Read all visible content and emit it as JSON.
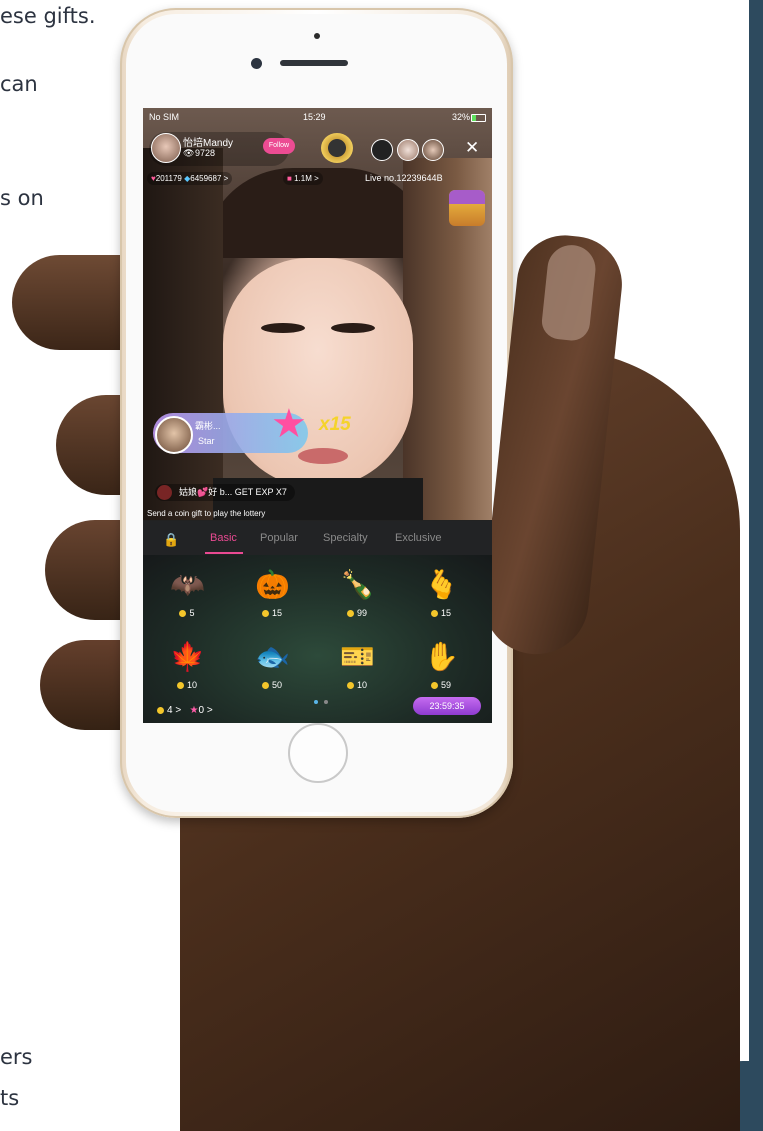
{
  "side_text": {
    "line1": "ese gifts.",
    "line2": "can",
    "line3": "s on",
    "line4": "ers",
    "line5": "ts"
  },
  "status_bar": {
    "carrier": "No SIM",
    "time": "15:29",
    "battery": "32%",
    "battery_level": 0.32
  },
  "streamer": {
    "name": "怡培Mandy",
    "viewers": "9728",
    "follow_label": "Follow"
  },
  "stats": {
    "likes": "201179",
    "diamonds": "6459687",
    "diamonds_more": ">",
    "gifts": "1.1M",
    "gifts_more": ">",
    "live_no": "Live no.12239644B"
  },
  "gift_event": {
    "user": "霸彬...",
    "gift_name": "Star",
    "count": "x15"
  },
  "chat": {
    "text": "姑娘💕好 b... GET EXP X7"
  },
  "lottery_text": "Send a coin gift to play the lottery",
  "tabs": [
    "Basic",
    "Popular",
    "Specialty",
    "Exclusive"
  ],
  "gifts": [
    {
      "name": "bat",
      "icon": "🦇",
      "price": "5"
    },
    {
      "name": "pumpkin",
      "icon": "🎃",
      "price": "15"
    },
    {
      "name": "champagne",
      "icon": "🍾",
      "price": "99"
    },
    {
      "name": "finger-heart",
      "icon": "🫰",
      "price": "15"
    },
    {
      "name": "maple-leaf",
      "icon": "🍁",
      "price": "10"
    },
    {
      "name": "fish",
      "icon": "🐟",
      "price": "50"
    },
    {
      "name": "ticket",
      "icon": "🎫",
      "price": "10"
    },
    {
      "name": "zombie-hand",
      "icon": "✋",
      "price": "59"
    }
  ],
  "footer": {
    "coins": "4",
    "coins_more": ">",
    "stars": "0",
    "stars_more": ">",
    "timer": "23:59:35"
  },
  "colors": {
    "accent_pink": "#e94a92",
    "coin_gold": "#f3c62b",
    "dark_panel": "#2d4a5e"
  }
}
